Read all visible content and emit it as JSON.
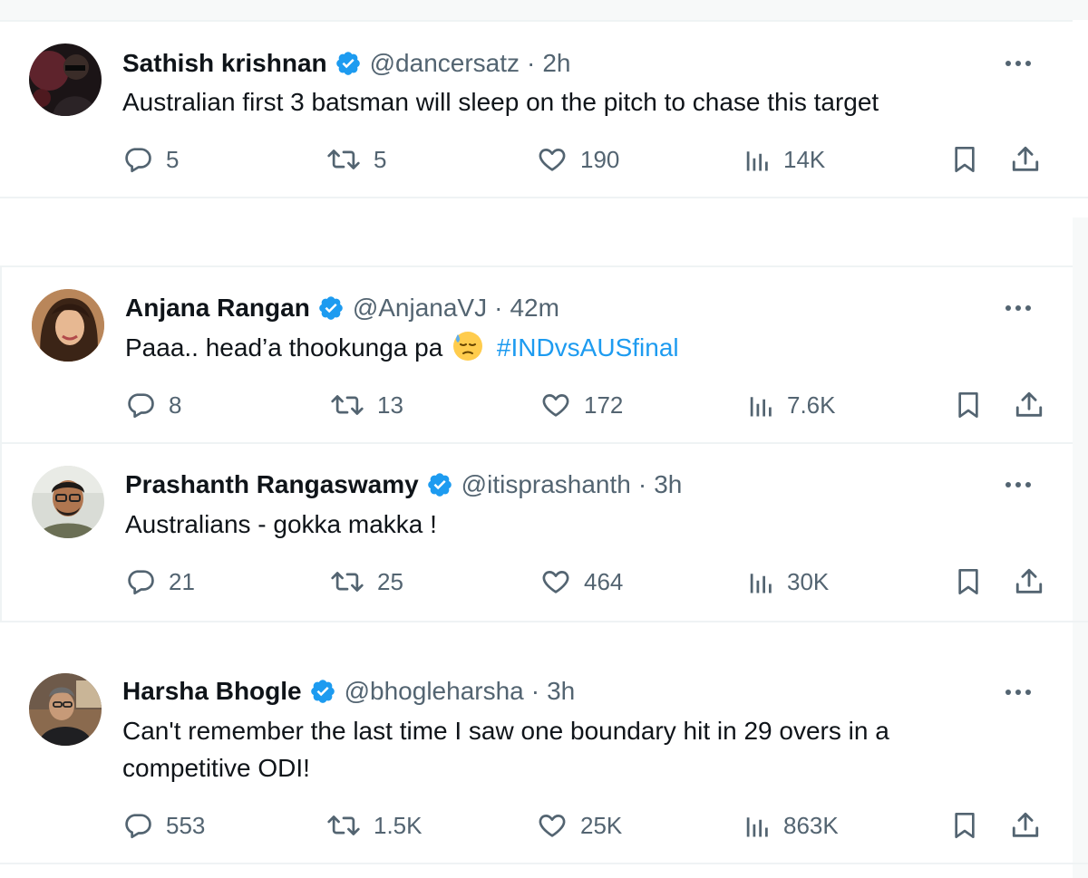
{
  "tweets": [
    {
      "name": "Sathish krishnan",
      "handle": "@dancersatz",
      "dot": "·",
      "time": "2h",
      "text": "Australian first 3 batsman will sleep on the pitch to chase this target",
      "replies": "5",
      "retweets": "5",
      "likes": "190",
      "views": "14K"
    },
    {
      "name": "Anjana Rangan",
      "handle": "@AnjanaVJ",
      "dot": "·",
      "time": "42m",
      "text": "Paaa.. head’a thookunga pa",
      "emoji": "downcast-face-with-sweat-icon",
      "hashtag": "#INDvsAUSfinal",
      "replies": "8",
      "retweets": "13",
      "likes": "172",
      "views": "7.6K"
    },
    {
      "name": "Prashanth Rangaswamy",
      "handle": "@itisprashanth",
      "dot": "·",
      "time": "3h",
      "text": "Australians - gokka makka !",
      "replies": "21",
      "retweets": "25",
      "likes": "464",
      "views": "30K"
    },
    {
      "name": "Harsha Bhogle",
      "handle": "@bhogleharsha",
      "dot": "·",
      "time": "3h",
      "text_line1": "Can't remember the last time I saw one boundary hit in 29 overs in a",
      "text_line2": "competitive ODI!",
      "replies": "553",
      "retweets": "1.5K",
      "likes": "25K",
      "views": "863K"
    }
  ],
  "colors": {
    "text": "#0f1419",
    "secondary": "#536471",
    "accent": "#1d9bf0",
    "divider": "#eff3f4"
  },
  "icons": {
    "verified": "verified-badge-icon",
    "more": "more-options-icon",
    "reply": "reply-icon",
    "retweet": "retweet-icon",
    "like": "heart-icon",
    "views": "views-icon",
    "bookmark": "bookmark-icon",
    "share": "share-icon"
  }
}
